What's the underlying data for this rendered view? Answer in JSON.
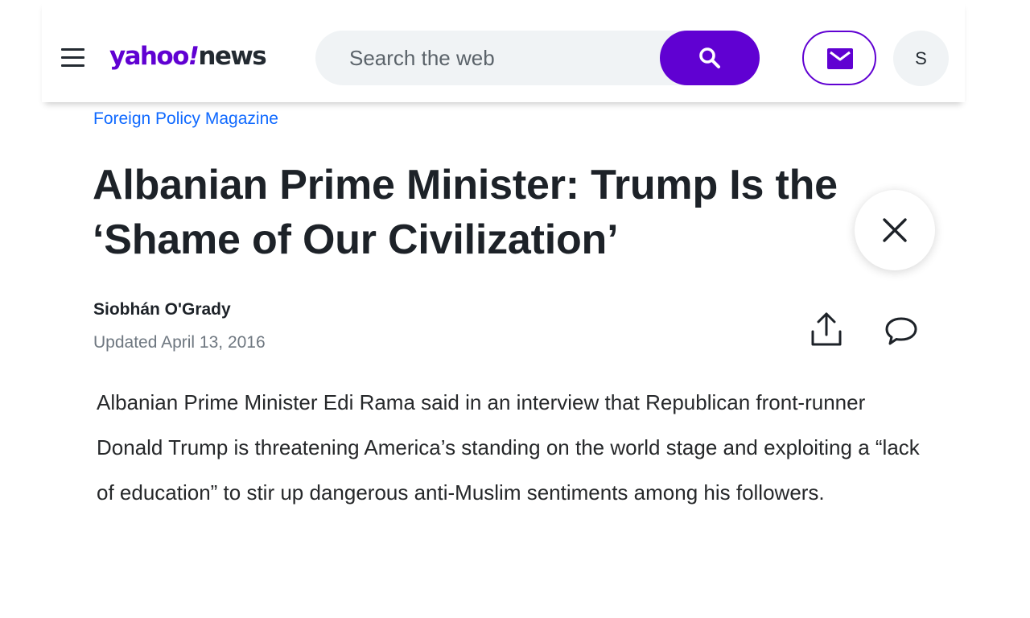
{
  "header": {
    "logo": {
      "brand": "yahoo",
      "mark": "!",
      "section": "news"
    },
    "search": {
      "placeholder": "Search the web"
    },
    "icons": {
      "menu": "hamburger-menu-icon",
      "search": "magnifier-icon",
      "mail": "envelope-icon"
    },
    "avatar_initial": "S"
  },
  "article": {
    "source": "Foreign Policy Magazine",
    "title": "Albanian Prime Minister: Trump Is the ‘Shame of Our Civilization’",
    "author": "Siobhán O'Grady",
    "updated": "Updated April 13, 2016",
    "body": "Albanian Prime Minister Edi Rama said in an interview that Republican front-runner Donald Trump is threatening America’s standing on the world stage and exploiting a “lack of education” to stir up dangerous anti-Muslim sentiments among his followers."
  },
  "actions": {
    "share": "share-icon",
    "comment": "comment-icon",
    "close": "close-icon"
  },
  "colors": {
    "accent": "#6001d2",
    "link": "#0f69ff",
    "text": "#1d2228",
    "muted": "#6e7780",
    "search_bg": "#f0f3f5"
  }
}
